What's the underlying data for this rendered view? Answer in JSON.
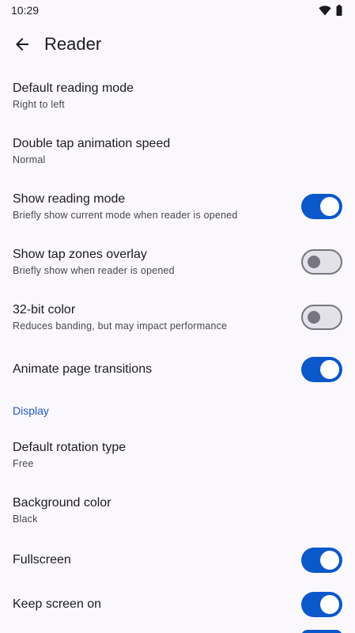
{
  "status_bar": {
    "time": "10:29"
  },
  "app_bar": {
    "title": "Reader"
  },
  "prefs": [
    {
      "title": "Default reading mode",
      "summary": "Right to left"
    },
    {
      "title": "Double tap animation speed",
      "summary": "Normal"
    },
    {
      "title": "Show reading mode",
      "summary": "Briefly show current mode when reader is opened",
      "checked": true
    },
    {
      "title": "Show tap zones overlay",
      "summary": "Briefly show when reader is opened",
      "checked": false
    },
    {
      "title": "32-bit color",
      "summary": "Reduces banding, but may impact performance",
      "checked": false
    },
    {
      "title": "Animate page transitions",
      "checked": true
    }
  ],
  "display_section": {
    "header": "Display",
    "prefs": [
      {
        "title": "Default rotation type",
        "summary": "Free"
      },
      {
        "title": "Background color",
        "summary": "Black"
      },
      {
        "title": "Fullscreen",
        "checked": true
      },
      {
        "title": "Keep screen on",
        "checked": true
      }
    ]
  },
  "colors": {
    "accent": "#0a58ca",
    "section_header": "#2157c4",
    "background": "#fbf8fd"
  }
}
